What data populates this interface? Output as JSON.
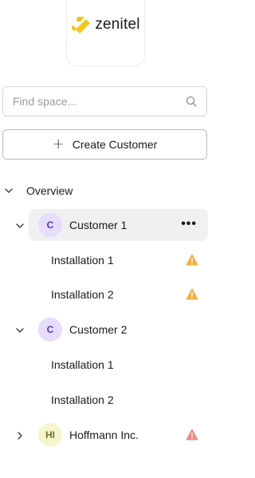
{
  "brand": {
    "name": "zenitel",
    "mark_color": "#f5c518"
  },
  "search": {
    "placeholder": "Find space..."
  },
  "create_button": {
    "label": "Create Customer"
  },
  "tree": {
    "overview": {
      "label": "Overview",
      "expanded": true
    },
    "customers": [
      {
        "initials": "C",
        "name": "Customer 1",
        "expanded": true,
        "selected": true,
        "installations": [
          {
            "name": "Installation 1",
            "status": "warning"
          },
          {
            "name": "Installation 2",
            "status": "warning"
          }
        ]
      },
      {
        "initials": "C",
        "name": "Customer 2",
        "expanded": true,
        "selected": false,
        "installations": [
          {
            "name": "Installation 1",
            "status": "none"
          },
          {
            "name": "Installation 2",
            "status": "none"
          }
        ]
      },
      {
        "initials": "HI",
        "name": "Hoffmann Inc.",
        "expanded": false,
        "selected": false,
        "status": "error"
      }
    ]
  },
  "colors": {
    "warning": "#f5b041",
    "error": "#f08a8a",
    "avatar_c": "#e6dcfb",
    "avatar_hi": "#f5f5cf"
  }
}
